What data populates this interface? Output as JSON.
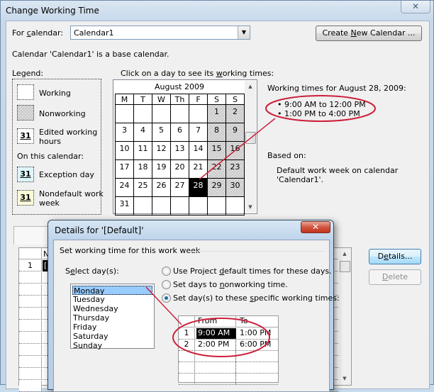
{
  "main_window": {
    "title": "Change Working Time",
    "close_icon": "close-icon"
  },
  "calendar_selector": {
    "label_prefix": "For ",
    "label_mnemonic": "c",
    "label_suffix": "alendar:",
    "value": "Calendar1",
    "create_button_prefix": "Create ",
    "create_button_mnemonic": "N",
    "create_button_suffix": "ew Calendar ..."
  },
  "base_calendar_note": "Calendar 'Calendar1' is a base calendar.",
  "legend": {
    "heading": "Legend:",
    "items": [
      {
        "label": "Working",
        "swatch": ""
      },
      {
        "label": "Nonworking",
        "swatch": ""
      },
      {
        "label": "Edited working hours",
        "line1": "Edited working",
        "line2": "hours",
        "swatch": "31"
      }
    ],
    "on_this_calendar": "On this calendar:",
    "calendar_items": [
      {
        "label": "Exception day",
        "swatch": "31",
        "color": "#ddf6fb"
      },
      {
        "label": "Nondefault work week",
        "line1": "Nondefault work",
        "line2": "week",
        "swatch": "31",
        "color": "#fcfad9"
      }
    ]
  },
  "calendar": {
    "instruction_prefix": "Click on a day to see its ",
    "instruction_mnemonic": "w",
    "instruction_suffix": "orking times:",
    "month": "August 2009",
    "weekdays": [
      "M",
      "T",
      "W",
      "Th",
      "F",
      "S",
      "S"
    ],
    "weeks": [
      [
        "",
        "",
        "",
        "",
        "",
        "1",
        "2"
      ],
      [
        "3",
        "4",
        "5",
        "6",
        "7",
        "8",
        "9"
      ],
      [
        "10",
        "11",
        "12",
        "13",
        "14",
        "15",
        "16"
      ],
      [
        "17",
        "18",
        "19",
        "20",
        "21",
        "22",
        "23"
      ],
      [
        "24",
        "25",
        "26",
        "27",
        "28",
        "29",
        "30"
      ],
      [
        "31",
        "",
        "",
        "",
        "",
        "",
        ""
      ]
    ],
    "selected_day": "28",
    "nonworking_columns": [
      5,
      6
    ]
  },
  "working_times": {
    "heading": "Working times for August 28, 2009:",
    "times": [
      "9:00 AM to 12:00 PM",
      "1:00 PM to 4:00 PM"
    ],
    "based_on_label": "Based on:",
    "based_on_line1": "Default work week on calendar",
    "based_on_line2": "'Calendar1'."
  },
  "work_weeks_grid": {
    "column_header": "Na",
    "rows": [
      {
        "num": "1",
        "name": "[D"
      }
    ]
  },
  "side_buttons": {
    "details_prefix": "D",
    "details_mnemonic": "e",
    "details_suffix": "tails...",
    "delete_mnemonic": "D",
    "delete_suffix": "elete"
  },
  "details_dialog": {
    "title": "Details for '[Default]'",
    "group_label": "Set working time for this work week",
    "select_days_prefix": "S",
    "select_days_mnemonic": "e",
    "select_days_suffix": "lect day(s):",
    "days": [
      "Monday",
      "Tuesday",
      "Wednesday",
      "Thursday",
      "Friday",
      "Saturday",
      "Sunday"
    ],
    "selected_day": "Monday",
    "options": [
      {
        "prefix": "Use Project ",
        "mnemonic": "d",
        "suffix": "efault times for these days.",
        "selected": false
      },
      {
        "prefix": "Set days to ",
        "mnemonic": "n",
        "suffix": "onworking time.",
        "selected": false
      },
      {
        "prefix": "Set day(s) to these ",
        "mnemonic": "s",
        "suffix": "pecific working times:",
        "selected": true
      }
    ],
    "times_grid": {
      "headers": [
        "From",
        "To"
      ],
      "rows": [
        {
          "num": "1",
          "from": "9:00 AM",
          "to": "1:00 PM"
        },
        {
          "num": "2",
          "from": "2:00 PM",
          "to": "6:00 PM"
        },
        {
          "num": "",
          "from": "",
          "to": ""
        },
        {
          "num": "",
          "from": "",
          "to": ""
        },
        {
          "num": "",
          "from": "",
          "to": ""
        }
      ]
    }
  },
  "annotation_color": "#cc1f3a"
}
